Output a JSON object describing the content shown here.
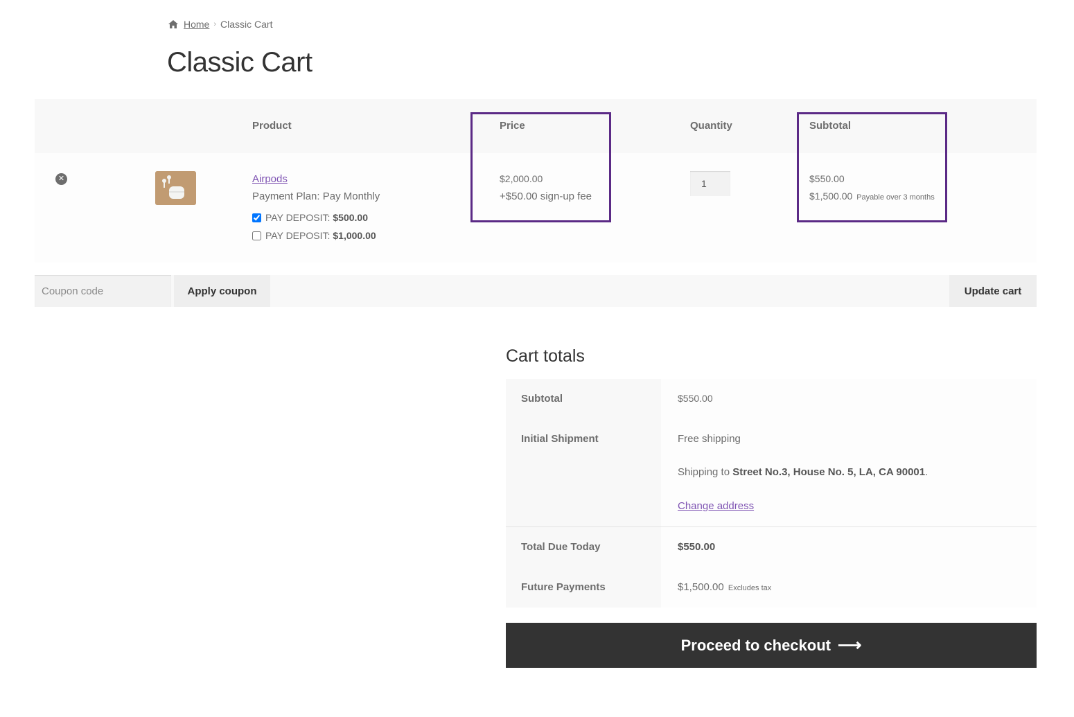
{
  "breadcrumb": {
    "home": "Home",
    "current": "Classic Cart"
  },
  "page_title": "Classic Cart",
  "cart_table": {
    "headers": {
      "product": "Product",
      "price": "Price",
      "quantity": "Quantity",
      "subtotal": "Subtotal"
    },
    "item": {
      "name": "Airpods",
      "payment_plan": "Payment Plan: Pay Monthly",
      "deposit_options": [
        {
          "label": "PAY DEPOSIT:",
          "amount": "$500.00",
          "checked": true
        },
        {
          "label": "PAY DEPOSIT:",
          "amount": "$1,000.00",
          "checked": false
        }
      ],
      "price": "$2,000.00",
      "signup_fee": "+$50.00 sign-up fee",
      "quantity": "1",
      "subtotal": "$550.00",
      "future_amount": "$1,500.00",
      "future_note": "Payable over 3 months"
    }
  },
  "actions": {
    "coupon_placeholder": "Coupon code",
    "apply_coupon": "Apply coupon",
    "update_cart": "Update cart"
  },
  "cart_totals": {
    "title": "Cart totals",
    "subtotal_label": "Subtotal",
    "subtotal_value": "$550.00",
    "shipment_label": "Initial Shipment",
    "shipping_method": "Free shipping",
    "shipping_to_prefix": "Shipping to",
    "shipping_address": "Street No.3, House No. 5, LA, CA 90001",
    "shipping_to_suffix": ".",
    "change_address": "Change address",
    "total_due_label": "Total Due Today",
    "total_due_value": "$550.00",
    "future_payments_label": "Future Payments",
    "future_payments_value": "$1,500.00",
    "future_payments_note": "Excludes tax"
  },
  "checkout_button": "Proceed to checkout",
  "colors": {
    "accent": "#7f54b3",
    "highlight": "#5b2a86",
    "button_dark": "#333333"
  },
  "icons": {
    "home": "home-icon",
    "remove": "remove-icon",
    "arrow": "arrow-right-icon"
  }
}
